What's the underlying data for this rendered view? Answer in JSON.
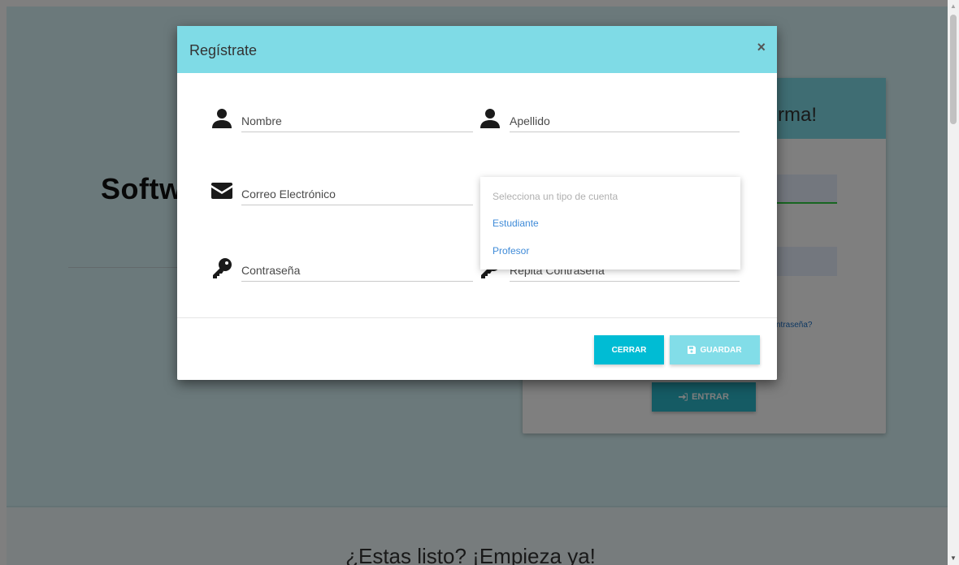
{
  "background": {
    "hero_title": "Softw",
    "login_header": "rma!",
    "forgot_link": "ntraseña?",
    "login_button": "ENTRAR",
    "bottom_text": "¿Estas listo? ¡Empieza ya!"
  },
  "modal": {
    "title": "Regístrate",
    "close_label": "×",
    "fields": {
      "nombre": "Nombre",
      "apellido": "Apellido",
      "correo": "Correo Electrónico",
      "contrasena": "Contraseña",
      "repita": "Repita Contraseña"
    },
    "account_type": {
      "placeholder": "Selecciona un tipo de cuenta",
      "options": [
        "Estudiante",
        "Profesor"
      ]
    },
    "buttons": {
      "cerrar": "CERRAR",
      "guardar": "GUARDAR"
    }
  },
  "colors": {
    "header": "#7fdbe6",
    "primary_button": "#00bcd4",
    "secondary_button": "#82dde8",
    "link": "#3f8bd8"
  },
  "icons": {
    "user": "user-icon",
    "mail": "envelope-icon",
    "key": "key-icon",
    "save": "save-icon",
    "login": "sign-in-icon"
  }
}
